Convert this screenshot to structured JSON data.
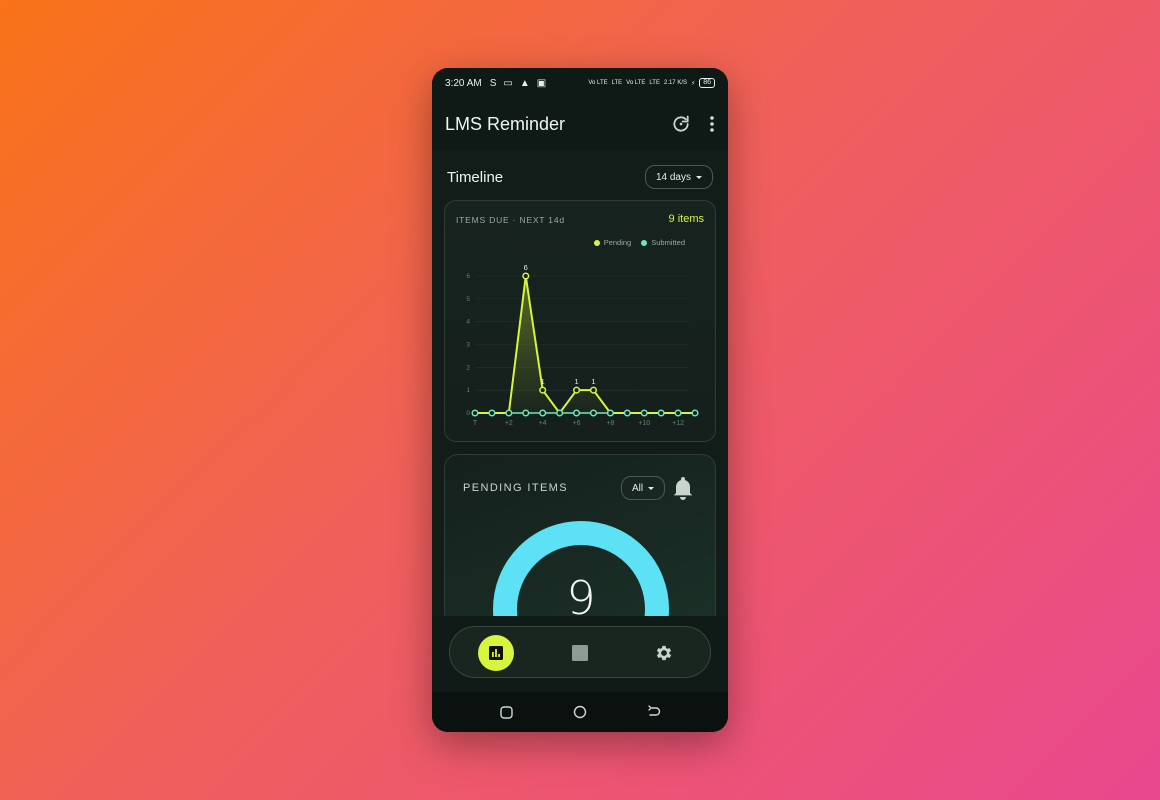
{
  "status_bar": {
    "time": "3:20 AM",
    "net1": "Vo LTE",
    "net2": "LTE",
    "net3": "Vo LTE",
    "net4": "LTE",
    "speed": "2.17 K/S",
    "battery": "86"
  },
  "app_bar": {
    "title": "LMS Reminder",
    "refresh_icon": "refresh-icon",
    "more_icon": "more-vert-icon"
  },
  "timeline": {
    "title": "Timeline",
    "range_label": "14 days"
  },
  "chart_card": {
    "label": "ITEMS DUE · NEXT 14d",
    "count": "9 items"
  },
  "chart_data": {
    "type": "line",
    "title": "ITEMS DUE · NEXT 14d",
    "x": [
      0,
      1,
      2,
      3,
      4,
      5,
      6,
      7,
      8,
      9,
      10,
      11,
      12,
      13
    ],
    "x_tick_labels": [
      "T",
      "+2",
      "+4",
      "+6",
      "+8",
      "+10",
      "+12"
    ],
    "x_tick_positions": [
      0,
      2,
      4,
      6,
      8,
      10,
      12
    ],
    "series": [
      {
        "name": "Pending",
        "color": "#d7f53d",
        "values": [
          0,
          0,
          0,
          6,
          1,
          0,
          1,
          1,
          0,
          0,
          0,
          0,
          0,
          0
        ],
        "labels": [
          "",
          "",
          "",
          "6",
          "1",
          "",
          "1",
          "1",
          "",
          "",
          "",
          "",
          "",
          ""
        ]
      },
      {
        "name": "Submitted",
        "color": "#6ee7b7",
        "values": [
          0,
          0,
          0,
          0,
          0,
          0,
          0,
          0,
          0,
          0,
          0,
          0,
          0,
          0
        ]
      }
    ],
    "ylim": [
      0,
      6
    ],
    "y_ticks": [
      0,
      1,
      2,
      3,
      4,
      5,
      6
    ],
    "grid": true,
    "legend": "top-right"
  },
  "pending": {
    "title": "PENDING ITEMS",
    "filter_label": "All",
    "count": "9",
    "bell_icon": "bell-icon",
    "gauge_color": "#5ce1f5"
  },
  "nav": {
    "items": [
      {
        "name": "dashboard",
        "icon": "bar-chart-icon"
      },
      {
        "name": "items",
        "icon": "square-icon"
      },
      {
        "name": "settings",
        "icon": "gear-icon"
      }
    ],
    "accent": "#d7f53d"
  }
}
